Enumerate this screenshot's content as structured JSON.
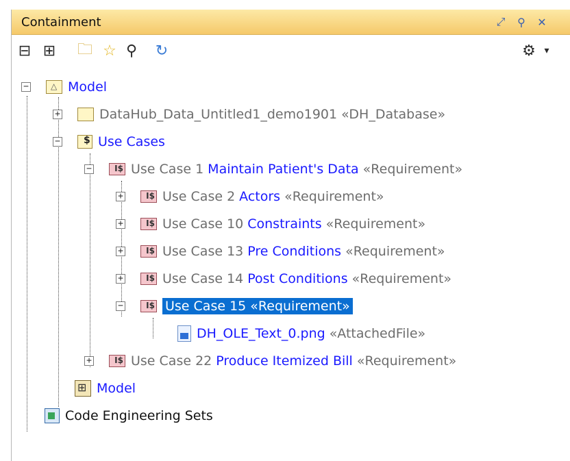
{
  "panel": {
    "title": "Containment",
    "title_icons": [
      "restore-icon",
      "pin-icon",
      "close-icon"
    ]
  },
  "toolbar": {
    "buttons": [
      "collapse-all-icon",
      "expand-all-icon",
      "open-folder-icon",
      "favorite-star-icon",
      "search-icon",
      "refresh-icon",
      "gear-icon"
    ],
    "menu_arrow": "▾"
  },
  "tree": {
    "model": {
      "label": "Model"
    },
    "datahub": {
      "label": "DataHub_Data_Untitled1_demo1901",
      "stereotype": "«DH_Database»"
    },
    "use_cases": {
      "label": "Use Cases"
    },
    "uc1": {
      "prefix": "Use Case 1 ",
      "name": "Maintain Patient's Data",
      "stereotype": " «Requirement»"
    },
    "uc2": {
      "prefix": "Use Case 2 ",
      "name": "Actors",
      "stereotype": " «Requirement»"
    },
    "uc10": {
      "prefix": "Use Case 10 ",
      "name": "Constraints",
      "stereotype": " «Requirement»"
    },
    "uc13": {
      "prefix": "Use Case 13 ",
      "name": "Pre Conditions",
      "stereotype": " «Requirement»"
    },
    "uc14": {
      "prefix": "Use Case 14 ",
      "name": "Post Conditions",
      "stereotype": " «Requirement»"
    },
    "uc15": {
      "label": "Use Case 15  «Requirement»"
    },
    "attached": {
      "label": "DH_OLE_Text_0.png",
      "stereotype": " «AttachedFile»"
    },
    "uc22": {
      "prefix": "Use Case 22 ",
      "name": "Produce Itemized Bill",
      "stereotype": " «Requirement»"
    },
    "model_diagram": {
      "label": "Model"
    },
    "code_sets": {
      "label": "Code Engineering Sets"
    }
  },
  "colors": {
    "title_bg": "#f5c96a",
    "link_blue": "#1a1aff",
    "selection": "#0a6ed1",
    "gray_text": "#6d6d6d"
  }
}
